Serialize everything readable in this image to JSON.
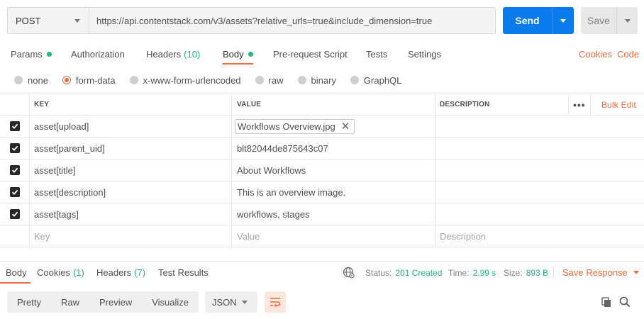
{
  "request": {
    "method": "POST",
    "url": "https://api.contentstack.com/v3/assets?relative_urls=true&include_dimension=true",
    "send_label": "Send",
    "save_label": "Save"
  },
  "tabs": {
    "params": "Params",
    "authorization": "Authorization",
    "headers": "Headers",
    "headers_count": "(10)",
    "body": "Body",
    "prerequest": "Pre-request Script",
    "tests": "Tests",
    "settings": "Settings",
    "cookies": "Cookies",
    "code": "Code"
  },
  "body_types": {
    "none": "none",
    "form_data": "form-data",
    "urlencoded": "x-www-form-urlencoded",
    "raw": "raw",
    "binary": "binary",
    "graphql": "GraphQL",
    "selected": "form-data"
  },
  "table": {
    "headers": {
      "key": "KEY",
      "value": "VALUE",
      "description": "DESCRIPTION",
      "bulk_edit": "Bulk Edit",
      "more": "•••"
    },
    "rows": [
      {
        "key": "asset[upload]",
        "value": "Workflows Overview.jpg",
        "checked": true
      },
      {
        "key": "asset[parent_uid]",
        "value": "blt82044de875643c07",
        "checked": true
      },
      {
        "key": "asset[title]",
        "value": "About Workflows",
        "checked": true
      },
      {
        "key": "asset[description]",
        "value": "This is an overview image.",
        "checked": true
      },
      {
        "key": "asset[tags]",
        "value": "workflows, stages",
        "checked": true
      }
    ],
    "placeholder": {
      "key": "Key",
      "value": "Value",
      "description": "Description"
    }
  },
  "response": {
    "tabs": {
      "body": "Body",
      "cookies": "Cookies",
      "cookies_count": "(1)",
      "headers": "Headers",
      "headers_count": "(7)",
      "test_results": "Test Results"
    },
    "status_label": "Status:",
    "status_value": "201 Created",
    "time_label": "Time:",
    "time_value": "2.99 s",
    "size_label": "Size:",
    "size_value": "893 B",
    "save_response": "Save Response"
  },
  "view": {
    "pretty": "Pretty",
    "raw": "Raw",
    "preview": "Preview",
    "visualize": "Visualize",
    "format": "JSON"
  },
  "colors": {
    "accent": "#f26b3a",
    "send": "#097bed",
    "success": "#26b47f"
  }
}
